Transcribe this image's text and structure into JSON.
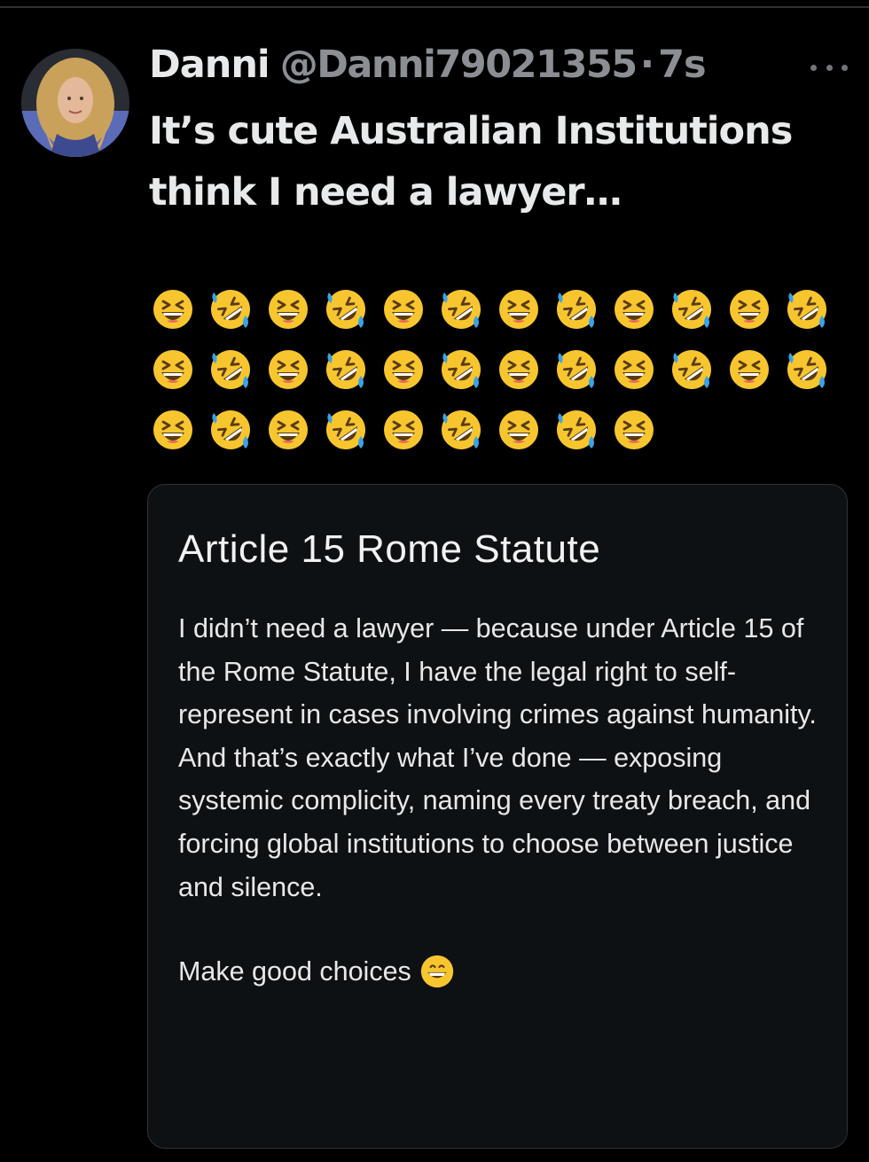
{
  "tweet": {
    "author_name": "Danni",
    "handle": "@Danni79021355",
    "separator": "·",
    "time": "7s",
    "more_icon": "more-horizontal-icon",
    "text": "It’s cute Australian Institutions think I need a lawyer…",
    "emoji_sequence": [
      "laughing",
      "rofl",
      "laughing",
      "rofl",
      "laughing",
      "rofl",
      "laughing",
      "rofl",
      "laughing",
      "rofl",
      "laughing",
      "rofl",
      "laughing",
      "rofl",
      "laughing",
      "rofl",
      "laughing",
      "rofl",
      "laughing",
      "rofl",
      "laughing",
      "rofl",
      "laughing",
      "rofl",
      "laughing",
      "rofl",
      "laughing",
      "rofl",
      "laughing",
      "rofl",
      "laughing",
      "rofl",
      "laughing"
    ]
  },
  "card": {
    "title": "Article 15 Rome Statute",
    "body": "I didn’t need a lawyer — because under Article 15 of the Rome Statute, I have the legal right to self-represent in cases involving crimes against humanity. And that’s exactly what I’ve done — exposing systemic complicity, naming every treaty breach, and forcing global institutions to choose between justice and silence.",
    "outro": "Make good choices",
    "outro_emoji": "grinning"
  },
  "colors": {
    "background": "#000000",
    "primary_text": "#e7e9ea",
    "secondary_text": "#8b8f94",
    "card_background": "#0e1114",
    "emoji_yellow": "#f7c62f"
  }
}
